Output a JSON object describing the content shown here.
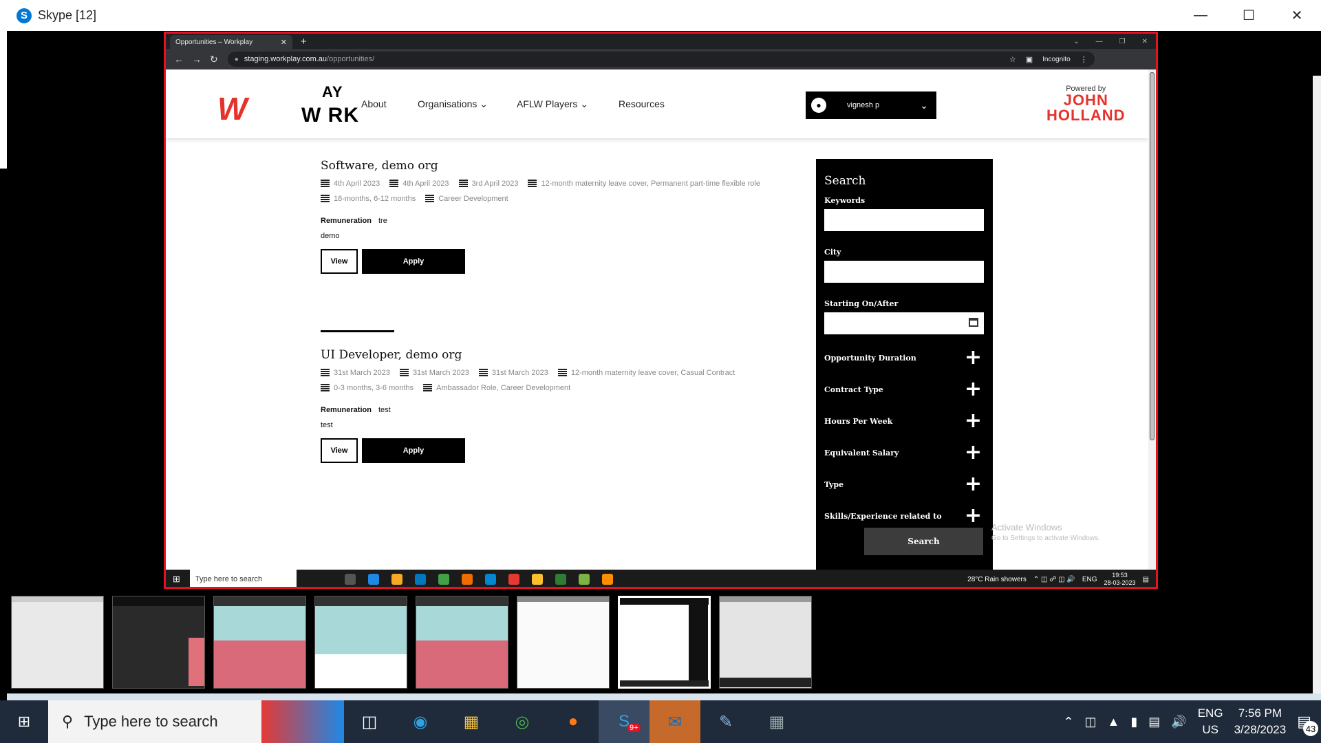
{
  "skype": {
    "title": "Skype [12]"
  },
  "browser": {
    "tab_title": "Opportunities – Workplay",
    "url_host": "staging.workplay.com.au",
    "url_path": "/opportunities/",
    "incognito_label": "Incognito"
  },
  "site": {
    "nav": {
      "about": "About",
      "organisations": "Organisations",
      "aflw": "AFLW Players",
      "resources": "Resources"
    },
    "user_name": "vignesh p",
    "powered_by": "Powered by",
    "partner_line1": "JOHN",
    "partner_line2": "HOLLAND",
    "logo_top": "AY",
    "logo_main": "W  RK"
  },
  "listings": [
    {
      "title": "Software, demo org",
      "meta_row1": [
        "4th April 2023",
        "4th April 2023",
        "3rd April 2023",
        "12-month maternity leave cover, Permanent part-time flexible role"
      ],
      "meta_row2": [
        "18-months, 6-12 months",
        "Career Development"
      ],
      "remuneration_label": "Remuneration",
      "remuneration_value": "tre",
      "note": "demo",
      "view_label": "View",
      "apply_label": "Apply"
    },
    {
      "title": "UI Developer, demo org",
      "meta_row1": [
        "31st March 2023",
        "31st March 2023",
        "31st March 2023",
        "12-month maternity leave cover, Casual Contract"
      ],
      "meta_row2": [
        "0-3 months, 3-6 months",
        "Ambassador Role, Career Development"
      ],
      "remuneration_label": "Remuneration",
      "remuneration_value": "test",
      "note": "test",
      "view_label": "View",
      "apply_label": "Apply"
    }
  ],
  "search": {
    "title": "Search",
    "keywords_label": "Keywords",
    "city_label": "City",
    "starting_label": "Starting On/After",
    "filters": [
      "Opportunity Duration",
      "Contract Type",
      "Hours Per Week",
      "Equivalent Salary",
      "Type",
      "Skills/Experience related to"
    ],
    "button_label": "Search"
  },
  "activate": {
    "title": "Activate Windows",
    "subtitle": "Go to Settings to activate Windows."
  },
  "inner_taskbar": {
    "search_placeholder": "Type here to search",
    "weather": "28°C  Rain showers",
    "lang": "ENG",
    "time": "19:53",
    "date": "28-03-2023"
  },
  "taskbar": {
    "search_placeholder": "Type here to search",
    "lang_line1": "ENG",
    "lang_line2": "US",
    "time": "7:56 PM",
    "date": "3/28/2023",
    "notifications": "43",
    "skype_badge": "9+"
  }
}
